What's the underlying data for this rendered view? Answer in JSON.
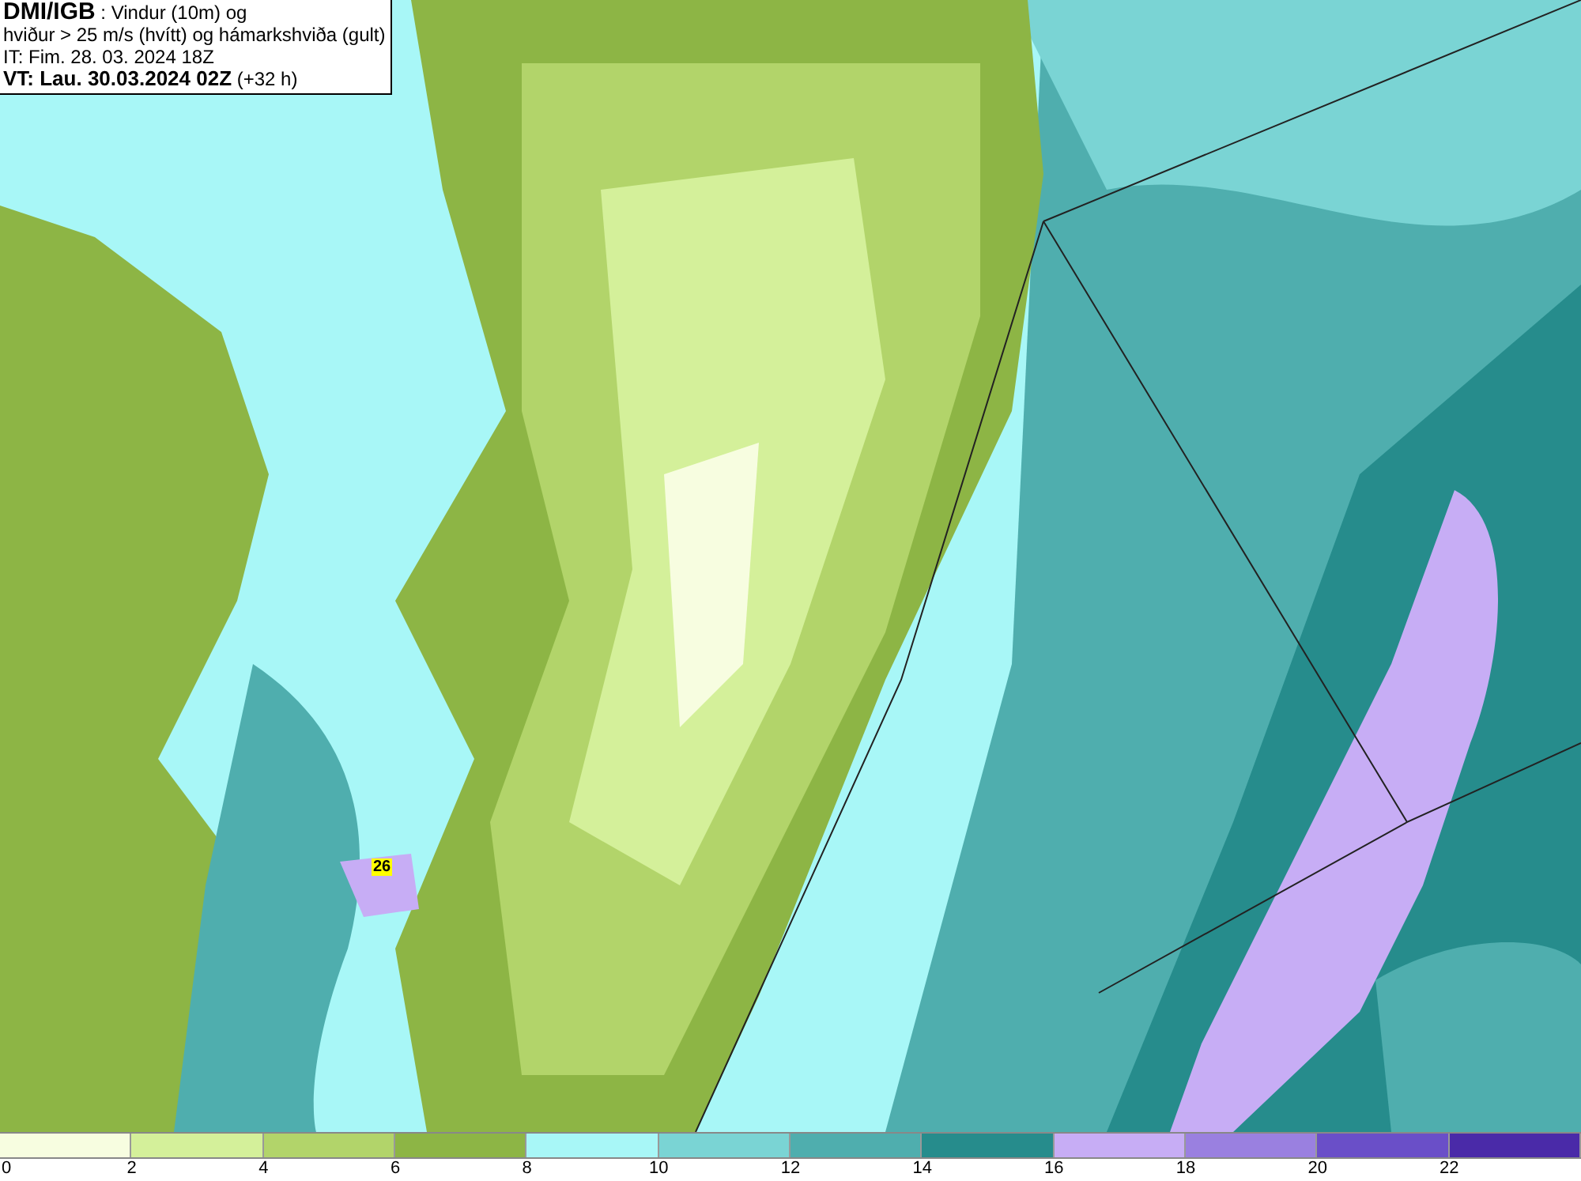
{
  "title_box": {
    "lines": [
      "**DMI/IGB** : Vindur (10m) og",
      "hviður > 25 m/s (hvítt) og hámarkshviða (gult)",
      "IT: Fim. 28. 03. 2024 18Z",
      "**VT: Lau. 30.03.2024 02Z** (+32 h)"
    ]
  },
  "map": {
    "gust_marker": "26"
  },
  "legend": [
    {
      "label": "0",
      "color": "#f7fde0"
    },
    {
      "label": "2",
      "color": "#d4f09a"
    },
    {
      "label": "4",
      "color": "#b2d46a"
    },
    {
      "label": "6",
      "color": "#8db545"
    },
    {
      "label": "8",
      "color": "#a8f7f7"
    },
    {
      "label": "10",
      "color": "#7ad4d4"
    },
    {
      "label": "12",
      "color": "#4faeae"
    },
    {
      "label": "14",
      "color": "#268c8c"
    },
    {
      "label": "16",
      "color": "#c7adf5"
    },
    {
      "label": "18",
      "color": "#9a80e0"
    },
    {
      "label": "20",
      "color": "#6a4fc8"
    },
    {
      "label": "22",
      "color": "#4a2aa8"
    }
  ]
}
